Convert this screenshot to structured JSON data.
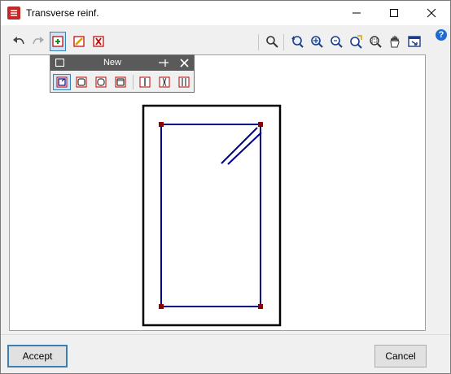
{
  "window": {
    "title": "Transverse reinf."
  },
  "floating_toolbar": {
    "title": "New"
  },
  "buttons": {
    "accept": "Accept",
    "cancel": "Cancel"
  },
  "help": {
    "label": "?"
  },
  "colors": {
    "stirrup": "#00008b",
    "bar": "#8b0000",
    "section": "#000000",
    "accent": "#3c7fb1"
  },
  "icons": {
    "toolbar": [
      "undo-icon",
      "redo-icon",
      "add-reinforcement-icon",
      "edit-reinforcement-icon",
      "delete-reinforcement-icon",
      "search-icon",
      "zoom-previous-icon",
      "zoom-all-icon",
      "zoom-in-icon",
      "zoom-extents-icon",
      "zoom-window-icon",
      "pan-hand-icon",
      "export-view-icon"
    ],
    "floating": [
      "stirrup-hooked-icon",
      "stirrup-closed-icon",
      "stirrup-rounded-icon",
      "stirrup-double-icon",
      "tie-straight-icon",
      "tie-bent-icon",
      "tie-double-icon"
    ]
  }
}
